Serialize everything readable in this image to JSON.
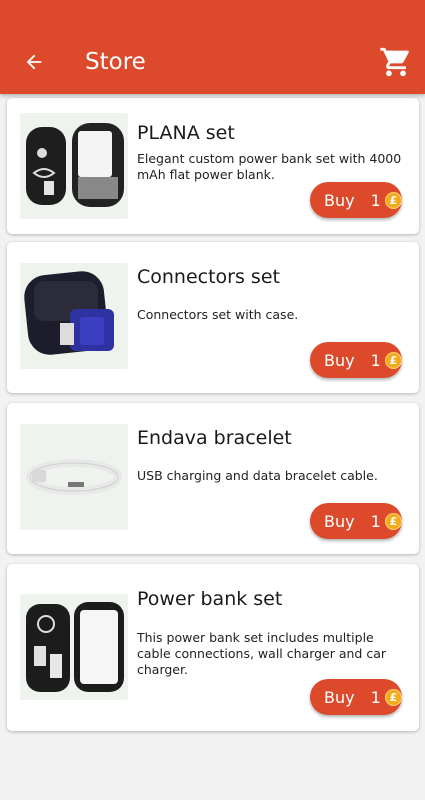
{
  "appbar": {
    "title": "Store",
    "back_icon": "arrow-left-icon",
    "cart_icon": "shopping-cart-icon",
    "color": "#dc4a2b"
  },
  "products": [
    {
      "name": "PLANA set",
      "description": "Elegant custom power bank set with 4000 mAh flat power blank.",
      "buy_label": "Buy",
      "price": "1",
      "coin_symbol": "£"
    },
    {
      "name": "Connectors set",
      "description": "Connectors set with case.",
      "buy_label": "Buy",
      "price": "1",
      "coin_symbol": "£"
    },
    {
      "name": "Endava bracelet",
      "description": "USB charging and data bracelet cable.",
      "buy_label": "Buy",
      "price": "1",
      "coin_symbol": "£"
    },
    {
      "name": "Power bank set",
      "description": "This power bank set includes multiple cable connections, wall charger and car charger.",
      "buy_label": "Buy",
      "price": "1",
      "coin_symbol": "£"
    }
  ]
}
